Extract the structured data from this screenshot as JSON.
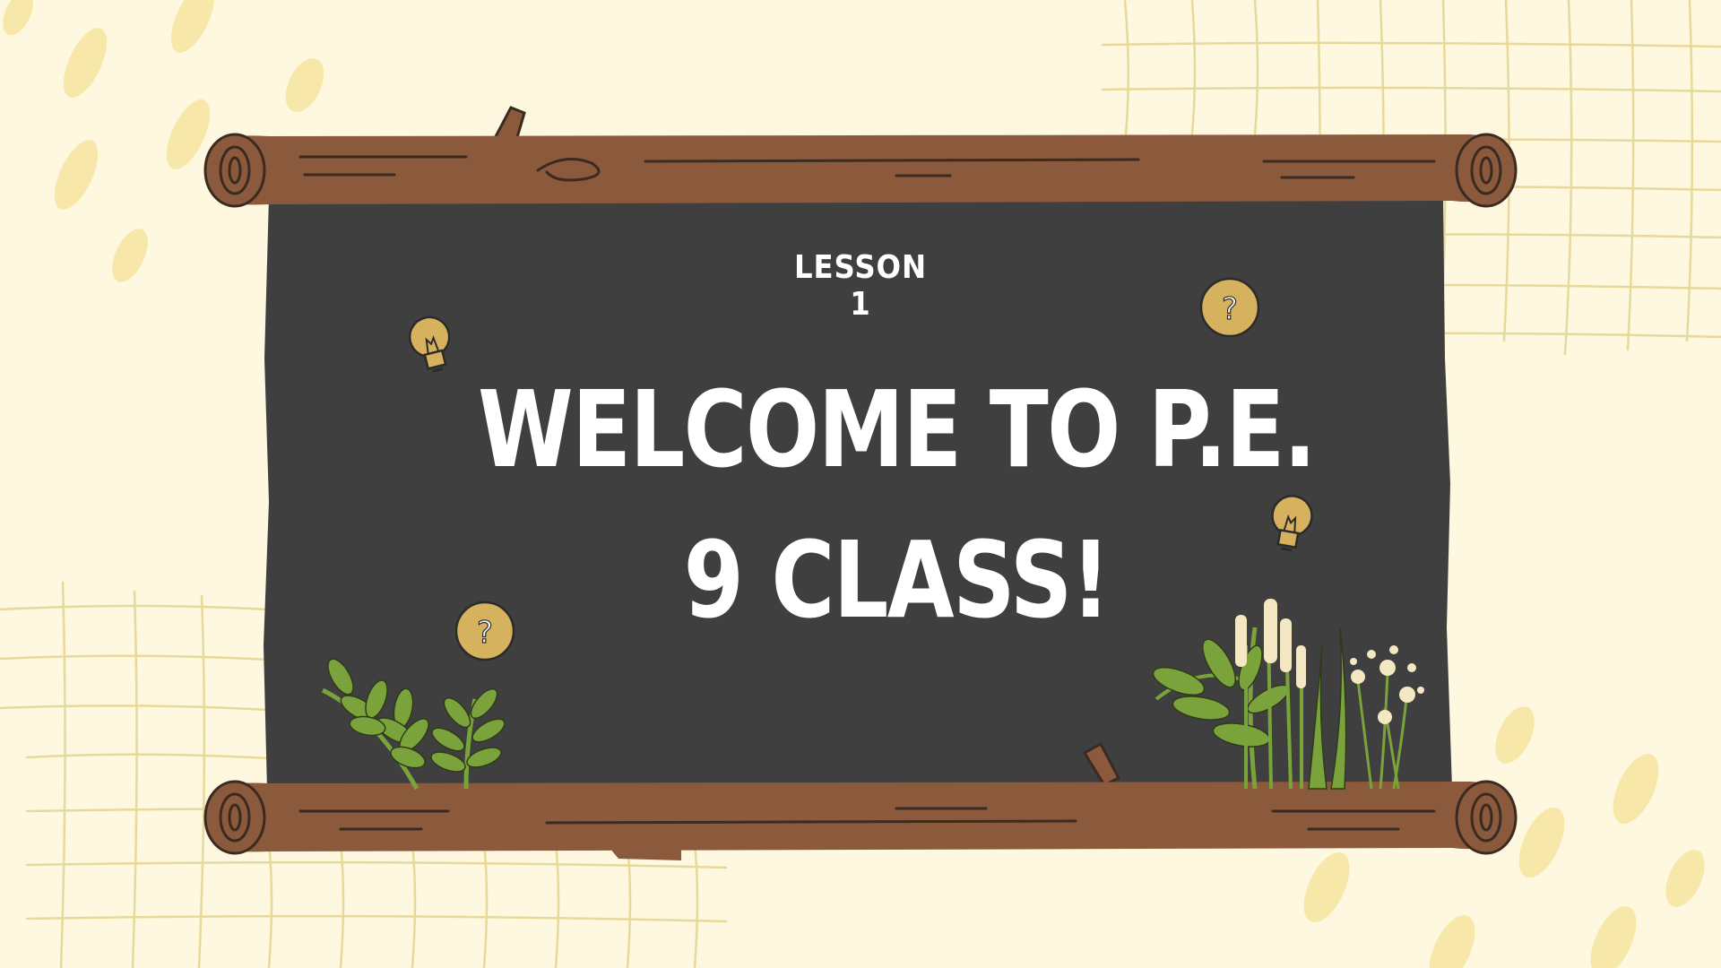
{
  "slide": {
    "kicker": "LESSON 1",
    "title_line1": "WELCOME TO P.E.",
    "title_line2": "9 CLASS!"
  },
  "colors": {
    "background": "#fdf8df",
    "chalkboard": "#3f3f3f",
    "wood": "#8b5a3c",
    "wood_lines": "#3a2a20",
    "grid_lines": "#e7d99a",
    "dots": "#f7e7a8",
    "leaf_green": "#7aa33c",
    "reed": "#f3e8c2",
    "badge": "#d6b25e",
    "text": "#ffffff"
  },
  "icons": [
    "lightbulb-icon",
    "question-mark-icon",
    "plant-icon",
    "log-icon"
  ]
}
